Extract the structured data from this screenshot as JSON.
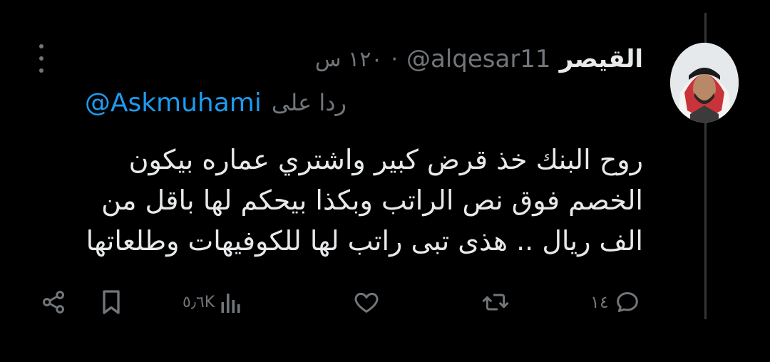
{
  "tweet": {
    "display_name": "القيصر",
    "handle": "@alqesar11",
    "separator": "·",
    "time": "١٢٠ س",
    "reply_prefix": "ردا على",
    "reply_to": "@Askmuhami",
    "text_lines": [
      "روح البنك خذ قرض كبير واشتري عماره بيكون",
      "الخصم فوق نص الراتب وبكذا بيحكم لها باقل من",
      "الف ريال .. هذى تبى راتب لها للكوفيهات وطلعاتها"
    ]
  },
  "actions": {
    "replies": "١٤",
    "retweets": "",
    "likes": "",
    "views": "٥٫٦K",
    "icons": [
      "reply-icon",
      "retweet-icon",
      "like-icon",
      "views-icon",
      "bookmark-icon",
      "share-icon"
    ]
  },
  "colors": {
    "background": "#000000",
    "text": "#e7e9ea",
    "secondary": "#71767b",
    "link": "#1d9bf0"
  }
}
